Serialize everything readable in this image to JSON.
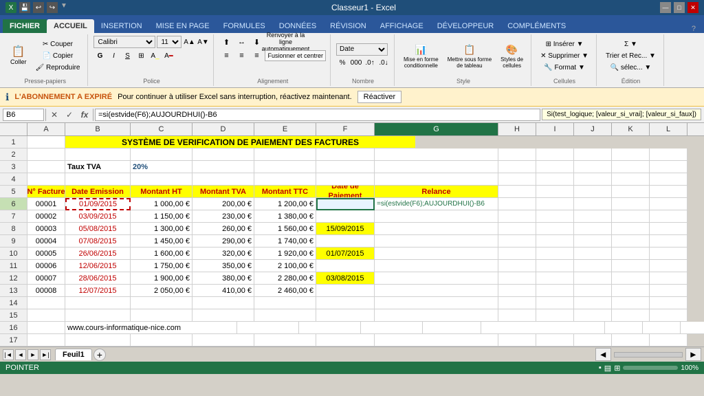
{
  "titleBar": {
    "title": "Classeur1 - Excel",
    "controls": [
      "—",
      "□",
      "✕"
    ]
  },
  "ribbonTabs": [
    {
      "label": "FICHIER",
      "active": false
    },
    {
      "label": "ACCUEIL",
      "active": true
    },
    {
      "label": "INSERTION",
      "active": false
    },
    {
      "label": "MISE EN PAGE",
      "active": false
    },
    {
      "label": "FORMULES",
      "active": false
    },
    {
      "label": "DONNÉES",
      "active": false
    },
    {
      "label": "RÉVISION",
      "active": false
    },
    {
      "label": "AFFICHAGE",
      "active": false
    },
    {
      "label": "DÉVELOPPEUR",
      "active": false
    },
    {
      "label": "COMPLÉMENTS",
      "active": false
    }
  ],
  "groups": {
    "pressePapiers": "Presse-papiers",
    "police": "Police",
    "alignement": "Alignement",
    "nombre": "Nombre",
    "style": "Style",
    "cellules": "Cellules",
    "edition": "Édition"
  },
  "notification": {
    "icon": "ℹ",
    "boldText": "L'ABONNEMENT A EXPIRÉ",
    "text": " Pour continuer à utiliser Excel sans interruption, réactivez maintenant.",
    "btnLabel": "Réactiver"
  },
  "formulaBar": {
    "cellRef": "B6",
    "cancelIcon": "✕",
    "confirmIcon": "✓",
    "fxIcon": "fx",
    "formula": "=si(estvide(F6);AUJOURDHUI()-B6",
    "tooltip": "Si(test_logique; [valeur_si_vrai]; [valeur_si_faux])"
  },
  "columns": [
    "A",
    "B",
    "C",
    "D",
    "E",
    "F",
    "G",
    "H",
    "I",
    "J",
    "K",
    "L"
  ],
  "spreadsheet": {
    "title": "SYSTÈME DE VERIFICATION DE PAIEMENT DES FACTURES",
    "tvaLabel": "Taux TVA",
    "tvaValue": "20%",
    "headers": {
      "nFacture": "N° Facture",
      "dateEmission": "Date Emission",
      "montantHT": "Montant HT",
      "montantTVA": "Montant TVA",
      "montantTTC": "Montant TTC",
      "datePaiement": "Date de Paiement",
      "relance": "Relance"
    },
    "rows": [
      {
        "num": "00001",
        "date": "01/09/2015",
        "ht": "1 000,00 €",
        "tva": "200,00 €",
        "ttc": "1 200,00 €",
        "paiement": "",
        "relance": "=si(estvide(F6);AUJOURDHUI()-B6",
        "dateRed": true,
        "isActive": true
      },
      {
        "num": "00002",
        "date": "03/09/2015",
        "ht": "1 150,00 €",
        "tva": "230,00 €",
        "ttc": "1 380,00 €",
        "paiement": "",
        "relance": "",
        "dateRed": true
      },
      {
        "num": "00003",
        "date": "05/08/2015",
        "ht": "1 300,00 €",
        "tva": "260,00 €",
        "ttc": "1 560,00 €",
        "paiement": "15/09/2015",
        "relance": "",
        "dateRed": true
      },
      {
        "num": "00004",
        "date": "07/08/2015",
        "ht": "1 450,00 €",
        "tva": "290,00 €",
        "ttc": "1 740,00 €",
        "paiement": "",
        "relance": "",
        "dateRed": true
      },
      {
        "num": "00005",
        "date": "26/06/2015",
        "ht": "1 600,00 €",
        "tva": "320,00 €",
        "ttc": "1 920,00 €",
        "paiement": "01/07/2015",
        "relance": "",
        "dateRed": true
      },
      {
        "num": "00006",
        "date": "12/06/2015",
        "ht": "1 750,00 €",
        "tva": "350,00 €",
        "ttc": "2 100,00 €",
        "paiement": "",
        "relance": "",
        "dateRed": true
      },
      {
        "num": "00007",
        "date": "28/06/2015",
        "ht": "1 900,00 €",
        "tva": "380,00 €",
        "ttc": "2 280,00 €",
        "paiement": "03/08/2015",
        "relance": "",
        "dateRed": true
      },
      {
        "num": "00008",
        "date": "12/07/2015",
        "ht": "2 050,00 €",
        "tva": "410,00 €",
        "ttc": "2 460,00 €",
        "paiement": "",
        "relance": "",
        "dateRed": true
      }
    ],
    "website": "www.cours-informatique-nice.com"
  },
  "sheetTabs": [
    {
      "label": "Feuil1",
      "active": true
    }
  ],
  "statusBar": {
    "left": "POINTER",
    "scrollLabel": "◄",
    "scrollRight": "►"
  }
}
